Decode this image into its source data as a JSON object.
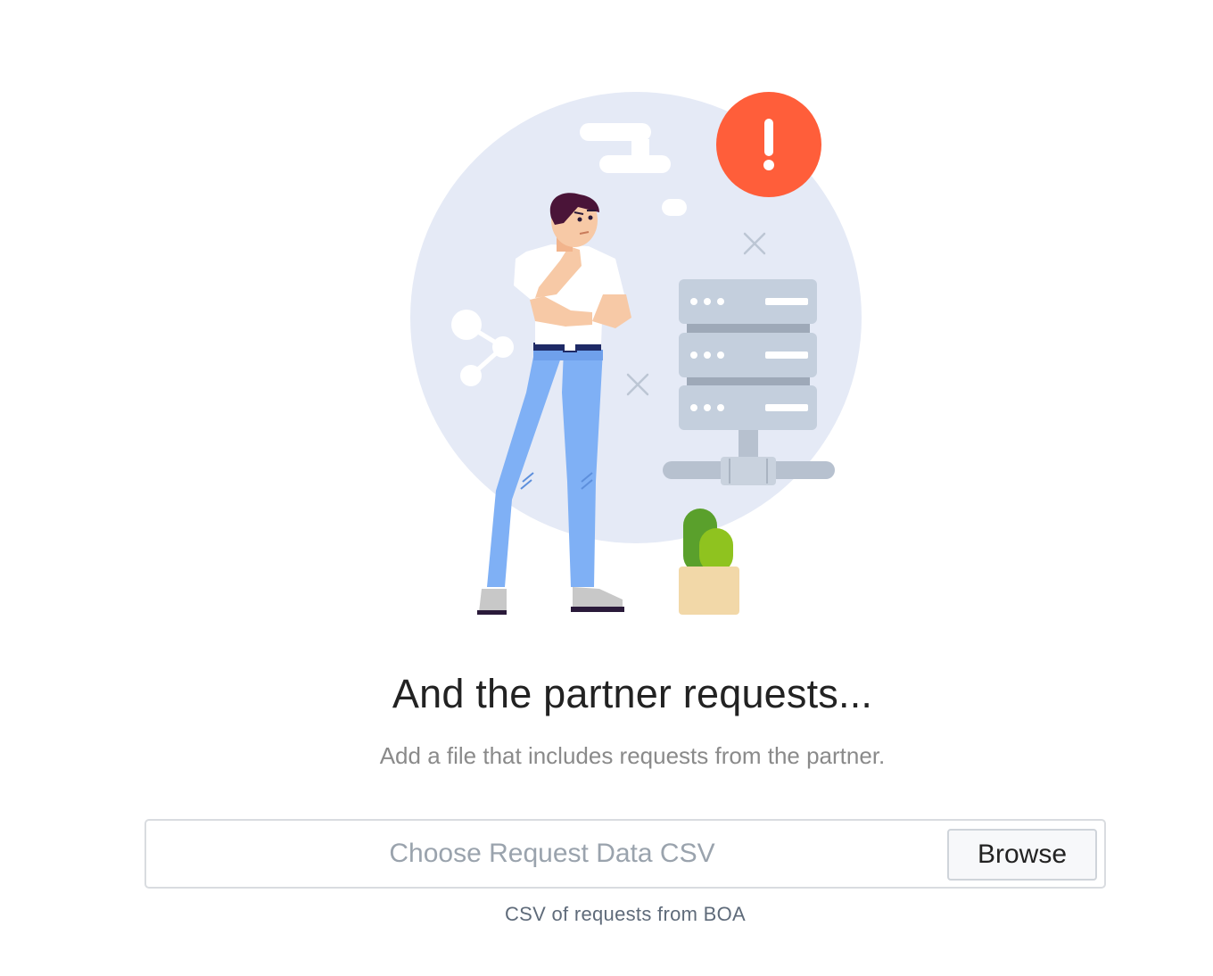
{
  "empty_state": {
    "title": "And the partner requests...",
    "description": "Add a file that includes requests from the partner."
  },
  "upload": {
    "placeholder": "Choose Request Data CSV",
    "browse_label": "Browse",
    "helper_text": "CSV of requests from BOA"
  },
  "illustration": {
    "alert_glyph": "!",
    "icons": [
      "person-thinking",
      "server-rack-icon",
      "alert-icon",
      "share-icon",
      "cactus-plant"
    ]
  },
  "colors": {
    "alert": "#ff5e3a",
    "backdrop": "#e5eaf6",
    "server": "#c4cfdd",
    "jeans": "#7fb0f5"
  }
}
